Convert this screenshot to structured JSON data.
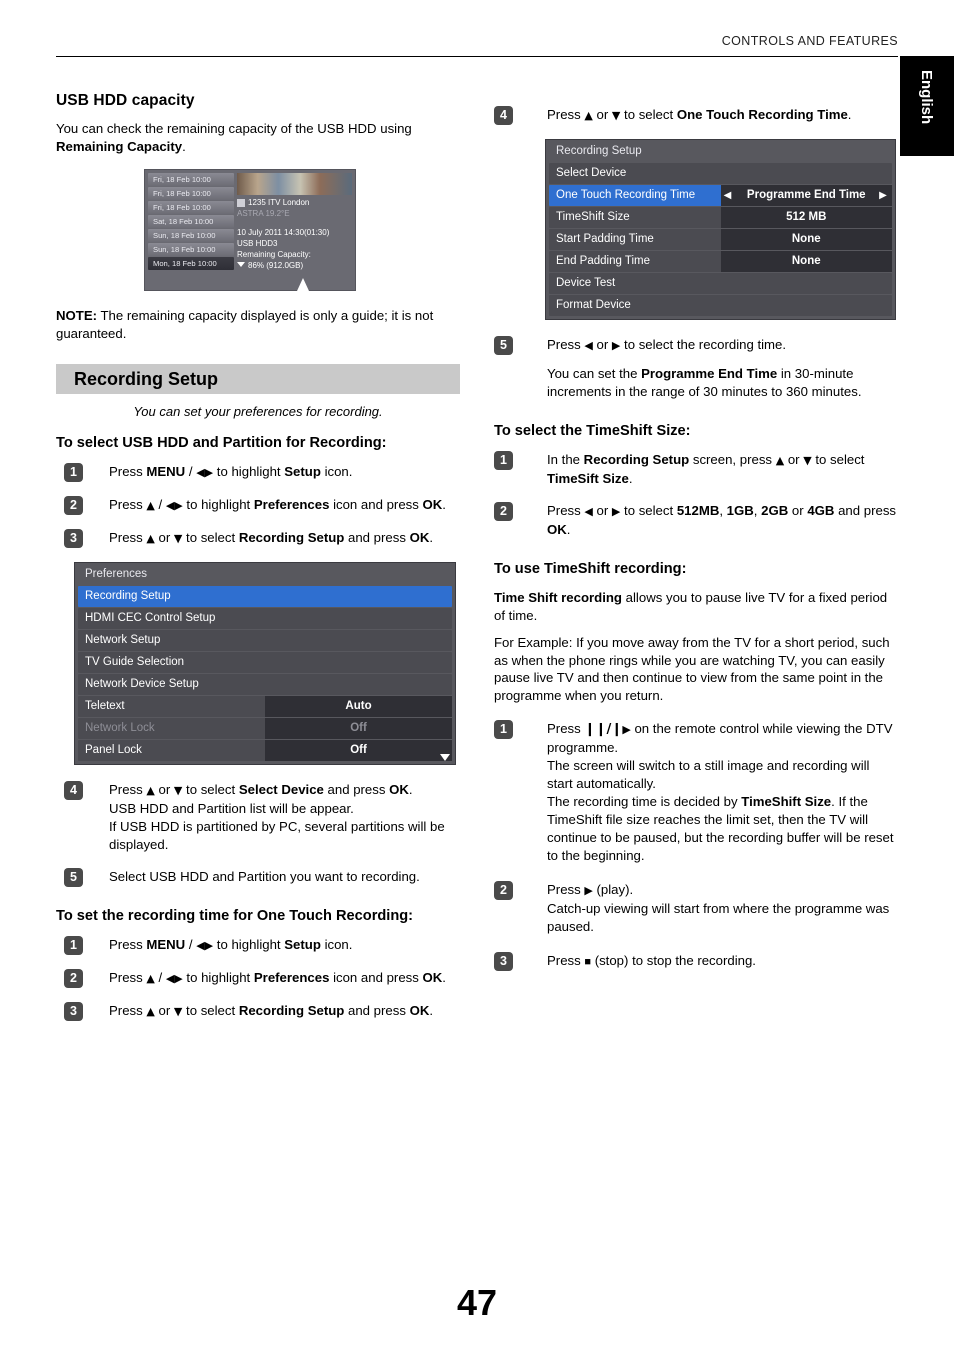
{
  "header": {
    "running_head": "CONTROLS AND FEATURES",
    "side_tab": "English",
    "page_number": "47"
  },
  "left": {
    "heading": "USB HDD capacity",
    "intro_a": "You can check the remaining capacity of the USB HDD using ",
    "intro_b": "Remaining Capacity",
    "intro_c": ".",
    "epg": {
      "rows": [
        "Fri, 18 Feb 10:00",
        "Fri, 18 Feb 10:00",
        "Fri, 18 Feb 10:00",
        "Sat, 18 Feb 10:00",
        "Sun, 18 Feb 10:00",
        "Sun, 18 Feb 10:00",
        "Mon, 18 Feb 10:00"
      ],
      "channel": "1235 ITV London",
      "satellite": "ASTRA 19.2°E",
      "datetime": "10 July 2011  14:30(01:30)",
      "device": "USB HDD3",
      "capacity_label": "Remaining Capacity:",
      "capacity_value": "86% (912.0GB)"
    },
    "note_label": "NOTE:",
    "note_text": " The remaining capacity displayed is only a guide; it is not guaranteed.",
    "band_title": "Recording Setup",
    "band_caption": "You can set your preferences for recording.",
    "sub_usb": "To select USB HDD and Partition for Recording:",
    "steps_usb": [
      {
        "n": "1",
        "html": "Press <b>MENU</b> / <span class=\"tri\">◀▶</span> to highlight <b>Setup</b> icon."
      },
      {
        "n": "2",
        "html": "Press <span class=\"tri\">▲</span> / <span class=\"tri\">◀▶</span> to highlight <b>Preferences</b> icon and press <b>OK</b>."
      },
      {
        "n": "3",
        "html": "Press <span class=\"tri\">▲</span> or <span class=\"tri\">▼</span> to select <b>Recording Setup</b> and press <b>OK</b>."
      }
    ],
    "prefs_menu": {
      "title": "Preferences",
      "rows": [
        {
          "label": "Recording Setup",
          "value": "",
          "state": "selected"
        },
        {
          "label": "HDMI CEC Control Setup",
          "value": "",
          "state": "normal"
        },
        {
          "label": "Network Setup",
          "value": "",
          "state": "normal"
        },
        {
          "label": "TV Guide Selection",
          "value": "",
          "state": "normal"
        },
        {
          "label": "Network Device Setup",
          "value": "",
          "state": "normal"
        },
        {
          "label": "Teletext",
          "value": "Auto",
          "state": "normal"
        },
        {
          "label": "Network Lock",
          "value": "Off",
          "state": "dim"
        },
        {
          "label": "Panel Lock",
          "value": "Off",
          "state": "normal"
        }
      ]
    },
    "steps_usb2": [
      {
        "n": "4",
        "html": "Press <span class=\"tri\">▲</span> or <span class=\"tri\">▼</span> to select <b>Select Device</b> and press <b>OK</b>.<br>USB HDD and Partition list will be appear.<br>If USB HDD is partitioned by PC, several partitions will be displayed."
      },
      {
        "n": "5",
        "html": "Select USB HDD and Partition you want to recording."
      }
    ],
    "sub_onetouch": "To set the recording time for One Touch Recording:",
    "steps_onetouch": [
      {
        "n": "1",
        "html": "Press <b>MENU</b> / <span class=\"tri\">◀▶</span> to highlight <b>Setup</b> icon."
      },
      {
        "n": "2",
        "html": "Press <span class=\"tri\">▲</span> / <span class=\"tri\">◀▶</span> to highlight <b>Preferences</b> icon and press <b>OK</b>."
      },
      {
        "n": "3",
        "html": "Press <span class=\"tri\">▲</span> or <span class=\"tri\">▼</span> to select <b>Recording Setup</b> and press <b>OK</b>."
      }
    ]
  },
  "right": {
    "step4": {
      "n": "4",
      "html": "Press <span class=\"tri\">▲</span> or <span class=\"tri\">▼</span> to select <b>One Touch Recording Time</b>."
    },
    "rec_menu": {
      "title": "Recording Setup",
      "rows": [
        {
          "label": "Select Device",
          "value": "",
          "state": "normal"
        },
        {
          "label": "One Touch Recording Time",
          "value": "Programme End Time",
          "state": "selected"
        },
        {
          "label": "TimeShift Size",
          "value": "512 MB",
          "state": "normal"
        },
        {
          "label": "Start Padding Time",
          "value": "None",
          "state": "normal"
        },
        {
          "label": "End Padding Time",
          "value": "None",
          "state": "normal"
        },
        {
          "label": "Device Test",
          "value": "",
          "state": "normal"
        },
        {
          "label": "Format Device",
          "value": "",
          "state": "normal"
        }
      ]
    },
    "step5": {
      "n": "5",
      "html": "Press <span class=\"tri\">◀</span> or <span class=\"tri\">▶</span> to select the recording time."
    },
    "step5_body": "You can set the <b>Programme End Time</b> in 30-minute increments in the range of 30 minutes to 360 minutes.",
    "sub_timeshift": "To select the TimeShift Size:",
    "steps_timeshift": [
      {
        "n": "1",
        "html": "In the <b>Recording Setup</b> screen, press <span class=\"tri\">▲</span> or <span class=\"tri\">▼</span> to select <b>TimeSift Size</b>."
      },
      {
        "n": "2",
        "html": "Press <span class=\"tri\">◀</span> or <span class=\"tri\">▶</span> to select <b>512MB</b>, <b>1GB</b>, <b>2GB</b> or <b>4GB</b> and press <b>OK</b>."
      }
    ],
    "sub_use_timeshift": "To use TimeShift recording:",
    "para1": "<b>Time Shift recording</b> allows you to pause live TV for a fixed period of time.",
    "para2": "For Example: If you move away from the TV for a short period, such as when the phone rings while you are watching TV, you can easily pause live TV and then continue to view from the same point in the programme when you return.",
    "steps_use": [
      {
        "n": "1",
        "html": "Press <span class=\"glyph-pause\">❙❙/❙</span><span class=\"tri\">▶</span> on the remote control while viewing the DTV programme.<br>The screen will switch to a still image and recording will start automatically.<br>The recording time is decided by <b>TimeShift Size</b>. If the TimeShift file size reaches the limit set, then the TV will continue to be paused, but the recording buffer will be reset to the beginning."
      },
      {
        "n": "2",
        "html": "Press <span class=\"tri\">▶</span> (play).<br>Catch-up viewing will start from where the programme was paused."
      },
      {
        "n": "3",
        "html": "Press <span style=\"font-size:11px\">■</span> (stop) to stop the recording."
      }
    ]
  }
}
